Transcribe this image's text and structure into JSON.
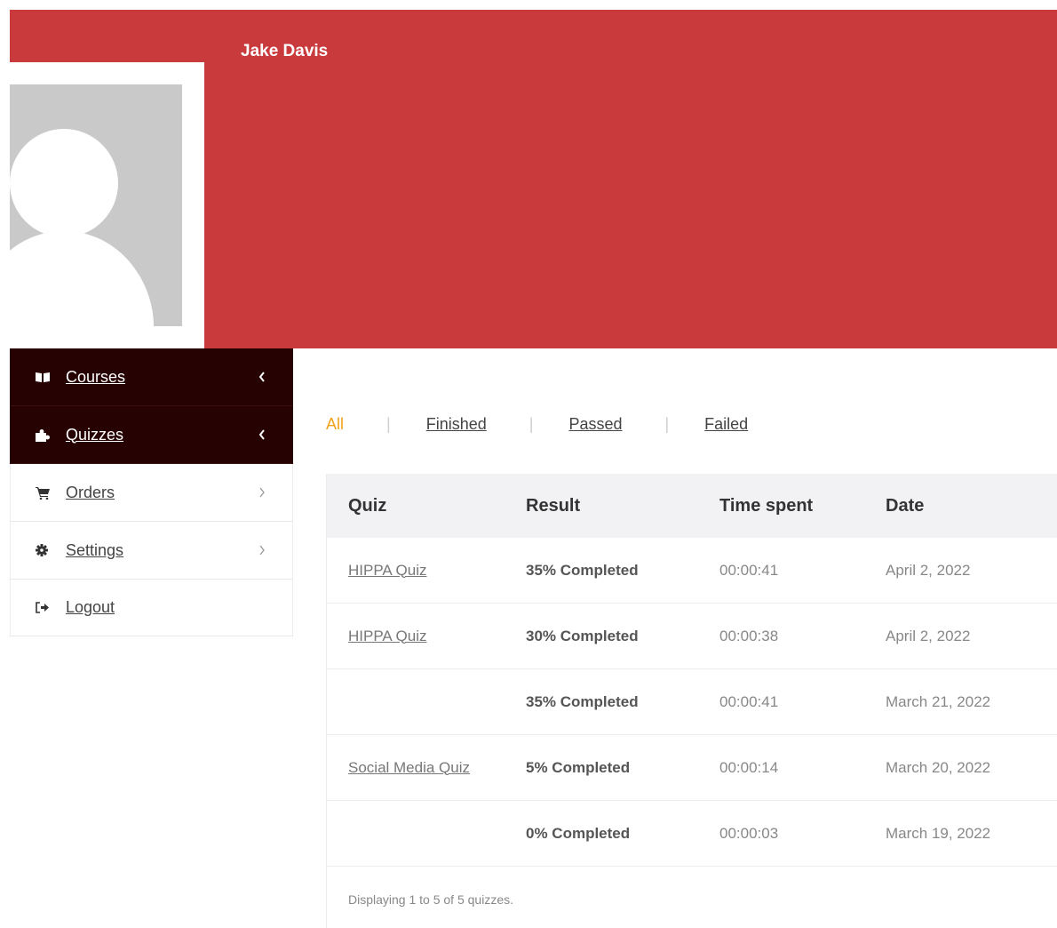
{
  "profile": {
    "name": "Jake Davis"
  },
  "sidebar": {
    "items": [
      {
        "label": "Courses",
        "icon": "book-icon",
        "chevron": "‹"
      },
      {
        "label": "Quizzes",
        "icon": "puzzle-icon",
        "chevron": "‹"
      },
      {
        "label": "Orders",
        "icon": "cart-icon",
        "chevron": "›"
      },
      {
        "label": "Settings",
        "icon": "gear-icon",
        "chevron": "›"
      },
      {
        "label": "Logout",
        "icon": "logout-icon",
        "chevron": ""
      }
    ]
  },
  "filters": {
    "all": "All",
    "finished": "Finished",
    "passed": "Passed",
    "failed": "Failed",
    "separator": "|"
  },
  "table": {
    "headers": {
      "quiz": "Quiz",
      "result": "Result",
      "time": "Time spent",
      "date": "Date"
    },
    "rows": [
      {
        "quiz": "HIPPA Quiz",
        "result": "35% Completed",
        "time": "00:00:41",
        "date": "April 2, 2022"
      },
      {
        "quiz": "HIPPA Quiz",
        "result": "30% Completed",
        "time": "00:00:38",
        "date": "April 2, 2022"
      },
      {
        "quiz": "",
        "result": "35% Completed",
        "time": "00:00:41",
        "date": "March 21, 2022"
      },
      {
        "quiz": "Social Media Quiz",
        "result": "5% Completed",
        "time": "00:00:14",
        "date": "March 20, 2022"
      },
      {
        "quiz": "",
        "result": "0% Completed",
        "time": "00:00:03",
        "date": "March 19, 2022"
      }
    ],
    "footer": "Displaying 1 to 5 of 5 quizzes."
  },
  "colors": {
    "banner": "#c93a3c",
    "sidebar_active": "#260202",
    "filter_active": "#f2a21a"
  }
}
